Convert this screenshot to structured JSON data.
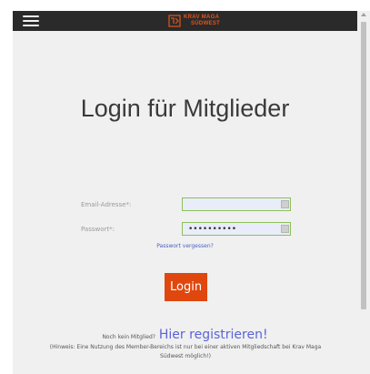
{
  "header": {
    "logo_line1": "KRAV MAGA",
    "logo_line2": "SÜDWEST",
    "brand_color": "#e2541c",
    "bar_color": "#2a2a2a",
    "menu_icon": "hamburger-icon"
  },
  "main": {
    "title": "Login für Mitglieder",
    "email_label": "Email-Adresse*:",
    "email_value": "",
    "password_label": "Passwort*:",
    "password_value": "••••••••••",
    "forgot_link": "Passwort vergessen?",
    "login_button": "Login",
    "login_button_color": "#e0470e",
    "no_member_text": "Noch kein Mitglied?",
    "register_link": "Hier registrieren!",
    "note": "(Hinweis: Eine Nutzung des Member-Bereichs ist nur bei einer aktiven Mitgliedschaft bei Krav Maga Südwest möglich!)"
  }
}
